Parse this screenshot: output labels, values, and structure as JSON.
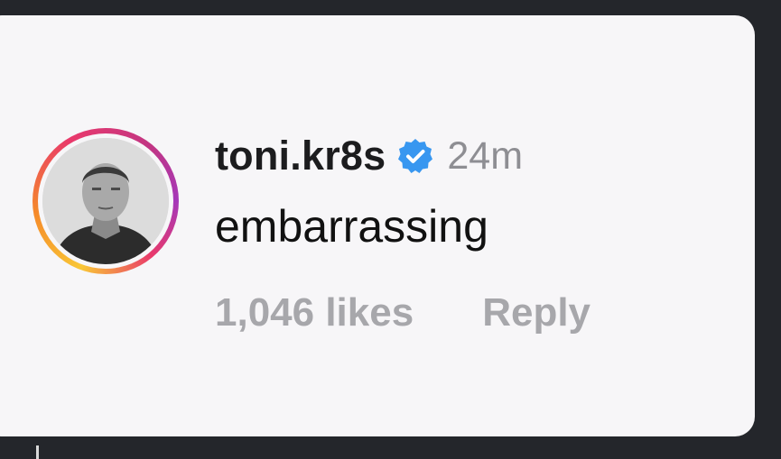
{
  "comment": {
    "username": "toni.kr8s",
    "time_ago": "24m",
    "text": "embarrassing",
    "likes": "1,046 likes",
    "reply_label": "Reply",
    "verified_icon": "verified-badge-icon",
    "avatar": "profile-photo"
  },
  "colors": {
    "background": "#24262b",
    "card": "#f7f6f8",
    "verified": "#3897f0",
    "muted_text": "#a7a7ab"
  }
}
